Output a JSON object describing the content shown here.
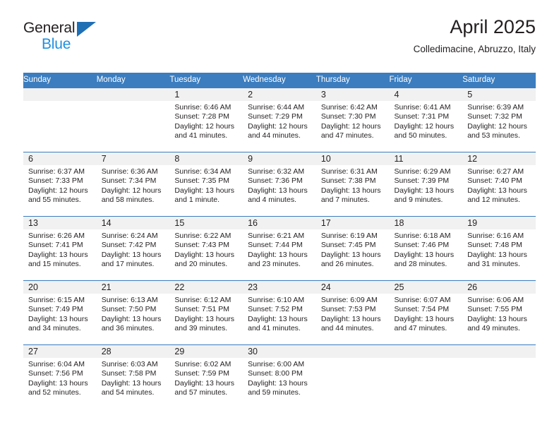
{
  "brand": {
    "name_top": "General",
    "name_bottom": "Blue",
    "triangle_color": "#1f6fb5",
    "blue_color": "#1f8fe0"
  },
  "header": {
    "title": "April 2025",
    "subtitle": "Colledimacine, Abruzzo, Italy"
  },
  "theme": {
    "header_bg": "#3b7dbf",
    "daynum_bg": "#f1f1f1",
    "text": "#231f20"
  },
  "weekdays": [
    "Sunday",
    "Monday",
    "Tuesday",
    "Wednesday",
    "Thursday",
    "Friday",
    "Saturday"
  ],
  "weeks": [
    [
      {
        "day": "",
        "sunrise": "",
        "sunset": "",
        "daylight_line1": "",
        "daylight_line2": ""
      },
      {
        "day": "",
        "sunrise": "",
        "sunset": "",
        "daylight_line1": "",
        "daylight_line2": ""
      },
      {
        "day": "1",
        "sunrise": "Sunrise: 6:46 AM",
        "sunset": "Sunset: 7:28 PM",
        "daylight_line1": "Daylight: 12 hours",
        "daylight_line2": "and 41 minutes."
      },
      {
        "day": "2",
        "sunrise": "Sunrise: 6:44 AM",
        "sunset": "Sunset: 7:29 PM",
        "daylight_line1": "Daylight: 12 hours",
        "daylight_line2": "and 44 minutes."
      },
      {
        "day": "3",
        "sunrise": "Sunrise: 6:42 AM",
        "sunset": "Sunset: 7:30 PM",
        "daylight_line1": "Daylight: 12 hours",
        "daylight_line2": "and 47 minutes."
      },
      {
        "day": "4",
        "sunrise": "Sunrise: 6:41 AM",
        "sunset": "Sunset: 7:31 PM",
        "daylight_line1": "Daylight: 12 hours",
        "daylight_line2": "and 50 minutes."
      },
      {
        "day": "5",
        "sunrise": "Sunrise: 6:39 AM",
        "sunset": "Sunset: 7:32 PM",
        "daylight_line1": "Daylight: 12 hours",
        "daylight_line2": "and 53 minutes."
      }
    ],
    [
      {
        "day": "6",
        "sunrise": "Sunrise: 6:37 AM",
        "sunset": "Sunset: 7:33 PM",
        "daylight_line1": "Daylight: 12 hours",
        "daylight_line2": "and 55 minutes."
      },
      {
        "day": "7",
        "sunrise": "Sunrise: 6:36 AM",
        "sunset": "Sunset: 7:34 PM",
        "daylight_line1": "Daylight: 12 hours",
        "daylight_line2": "and 58 minutes."
      },
      {
        "day": "8",
        "sunrise": "Sunrise: 6:34 AM",
        "sunset": "Sunset: 7:35 PM",
        "daylight_line1": "Daylight: 13 hours",
        "daylight_line2": "and 1 minute."
      },
      {
        "day": "9",
        "sunrise": "Sunrise: 6:32 AM",
        "sunset": "Sunset: 7:36 PM",
        "daylight_line1": "Daylight: 13 hours",
        "daylight_line2": "and 4 minutes."
      },
      {
        "day": "10",
        "sunrise": "Sunrise: 6:31 AM",
        "sunset": "Sunset: 7:38 PM",
        "daylight_line1": "Daylight: 13 hours",
        "daylight_line2": "and 7 minutes."
      },
      {
        "day": "11",
        "sunrise": "Sunrise: 6:29 AM",
        "sunset": "Sunset: 7:39 PM",
        "daylight_line1": "Daylight: 13 hours",
        "daylight_line2": "and 9 minutes."
      },
      {
        "day": "12",
        "sunrise": "Sunrise: 6:27 AM",
        "sunset": "Sunset: 7:40 PM",
        "daylight_line1": "Daylight: 13 hours",
        "daylight_line2": "and 12 minutes."
      }
    ],
    [
      {
        "day": "13",
        "sunrise": "Sunrise: 6:26 AM",
        "sunset": "Sunset: 7:41 PM",
        "daylight_line1": "Daylight: 13 hours",
        "daylight_line2": "and 15 minutes."
      },
      {
        "day": "14",
        "sunrise": "Sunrise: 6:24 AM",
        "sunset": "Sunset: 7:42 PM",
        "daylight_line1": "Daylight: 13 hours",
        "daylight_line2": "and 17 minutes."
      },
      {
        "day": "15",
        "sunrise": "Sunrise: 6:22 AM",
        "sunset": "Sunset: 7:43 PM",
        "daylight_line1": "Daylight: 13 hours",
        "daylight_line2": "and 20 minutes."
      },
      {
        "day": "16",
        "sunrise": "Sunrise: 6:21 AM",
        "sunset": "Sunset: 7:44 PM",
        "daylight_line1": "Daylight: 13 hours",
        "daylight_line2": "and 23 minutes."
      },
      {
        "day": "17",
        "sunrise": "Sunrise: 6:19 AM",
        "sunset": "Sunset: 7:45 PM",
        "daylight_line1": "Daylight: 13 hours",
        "daylight_line2": "and 26 minutes."
      },
      {
        "day": "18",
        "sunrise": "Sunrise: 6:18 AM",
        "sunset": "Sunset: 7:46 PM",
        "daylight_line1": "Daylight: 13 hours",
        "daylight_line2": "and 28 minutes."
      },
      {
        "day": "19",
        "sunrise": "Sunrise: 6:16 AM",
        "sunset": "Sunset: 7:48 PM",
        "daylight_line1": "Daylight: 13 hours",
        "daylight_line2": "and 31 minutes."
      }
    ],
    [
      {
        "day": "20",
        "sunrise": "Sunrise: 6:15 AM",
        "sunset": "Sunset: 7:49 PM",
        "daylight_line1": "Daylight: 13 hours",
        "daylight_line2": "and 34 minutes."
      },
      {
        "day": "21",
        "sunrise": "Sunrise: 6:13 AM",
        "sunset": "Sunset: 7:50 PM",
        "daylight_line1": "Daylight: 13 hours",
        "daylight_line2": "and 36 minutes."
      },
      {
        "day": "22",
        "sunrise": "Sunrise: 6:12 AM",
        "sunset": "Sunset: 7:51 PM",
        "daylight_line1": "Daylight: 13 hours",
        "daylight_line2": "and 39 minutes."
      },
      {
        "day": "23",
        "sunrise": "Sunrise: 6:10 AM",
        "sunset": "Sunset: 7:52 PM",
        "daylight_line1": "Daylight: 13 hours",
        "daylight_line2": "and 41 minutes."
      },
      {
        "day": "24",
        "sunrise": "Sunrise: 6:09 AM",
        "sunset": "Sunset: 7:53 PM",
        "daylight_line1": "Daylight: 13 hours",
        "daylight_line2": "and 44 minutes."
      },
      {
        "day": "25",
        "sunrise": "Sunrise: 6:07 AM",
        "sunset": "Sunset: 7:54 PM",
        "daylight_line1": "Daylight: 13 hours",
        "daylight_line2": "and 47 minutes."
      },
      {
        "day": "26",
        "sunrise": "Sunrise: 6:06 AM",
        "sunset": "Sunset: 7:55 PM",
        "daylight_line1": "Daylight: 13 hours",
        "daylight_line2": "and 49 minutes."
      }
    ],
    [
      {
        "day": "27",
        "sunrise": "Sunrise: 6:04 AM",
        "sunset": "Sunset: 7:56 PM",
        "daylight_line1": "Daylight: 13 hours",
        "daylight_line2": "and 52 minutes."
      },
      {
        "day": "28",
        "sunrise": "Sunrise: 6:03 AM",
        "sunset": "Sunset: 7:58 PM",
        "daylight_line1": "Daylight: 13 hours",
        "daylight_line2": "and 54 minutes."
      },
      {
        "day": "29",
        "sunrise": "Sunrise: 6:02 AM",
        "sunset": "Sunset: 7:59 PM",
        "daylight_line1": "Daylight: 13 hours",
        "daylight_line2": "and 57 minutes."
      },
      {
        "day": "30",
        "sunrise": "Sunrise: 6:00 AM",
        "sunset": "Sunset: 8:00 PM",
        "daylight_line1": "Daylight: 13 hours",
        "daylight_line2": "and 59 minutes."
      },
      {
        "day": "",
        "sunrise": "",
        "sunset": "",
        "daylight_line1": "",
        "daylight_line2": ""
      },
      {
        "day": "",
        "sunrise": "",
        "sunset": "",
        "daylight_line1": "",
        "daylight_line2": ""
      },
      {
        "day": "",
        "sunrise": "",
        "sunset": "",
        "daylight_line1": "",
        "daylight_line2": ""
      }
    ]
  ]
}
